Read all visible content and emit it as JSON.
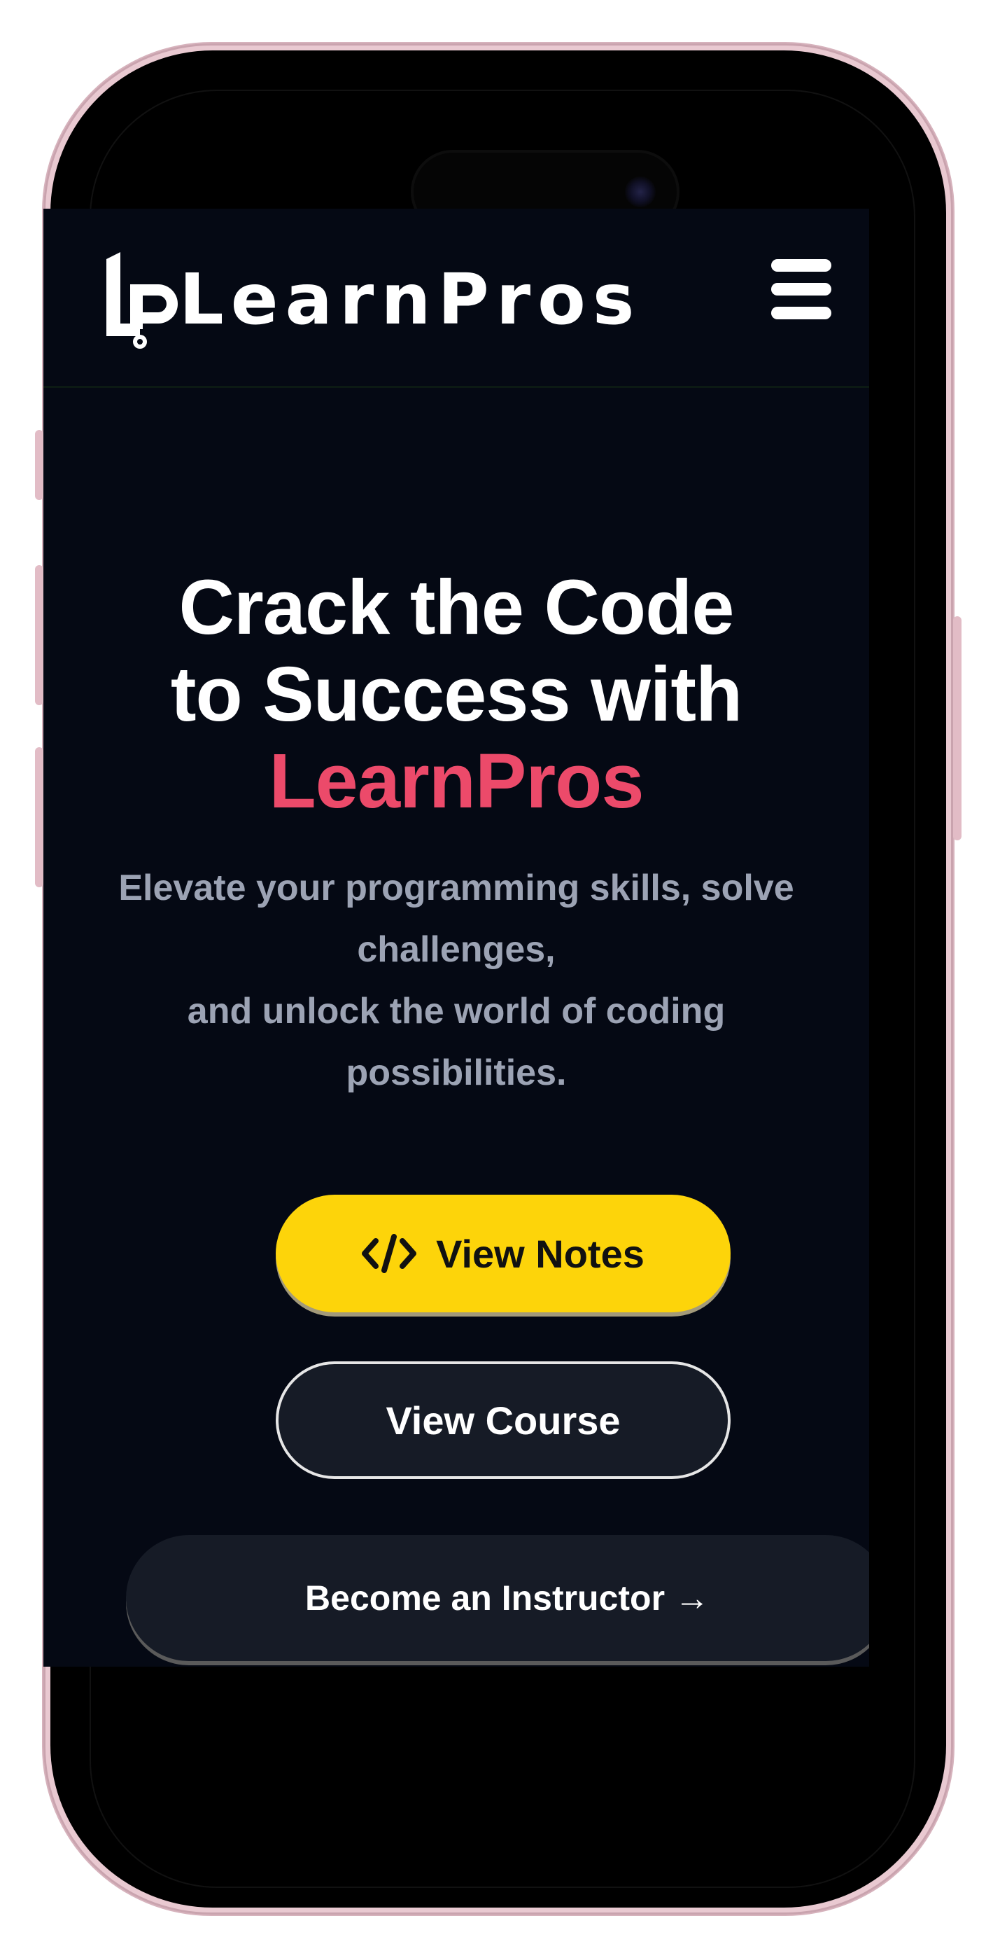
{
  "brand": {
    "name": "LearnPros"
  },
  "nav": {
    "menu_icon": "hamburger-menu-icon"
  },
  "hero": {
    "headline_line1": "Crack the Code",
    "headline_line2": "to Success with",
    "headline_accent": "LearnPros",
    "subtitle_line1": "Elevate your programming skills, solve",
    "subtitle_line2": "challenges,",
    "subtitle_line3": "and unlock the world of coding",
    "subtitle_line4": "possibilities."
  },
  "actions": {
    "notes_label": "View Notes",
    "notes_icon": "code-icon",
    "course_label": "View Course",
    "instructor_label": "Become an Instructor →"
  },
  "colors": {
    "page_bg": "#050914",
    "accent_pink": "#ec4a6a",
    "primary_yellow": "#fdd40a",
    "secondary_bg": "#161b26",
    "subtitle_gray": "#9ca3b4"
  }
}
